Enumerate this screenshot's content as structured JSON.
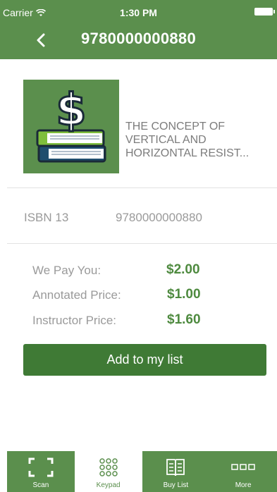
{
  "status": {
    "carrier": "Carrier",
    "time": "1:30 PM"
  },
  "header": {
    "title": "9780000000880"
  },
  "book": {
    "title": "THE CONCEPT OF VERTICAL AND HORIZONTAL RESIST..."
  },
  "isbn": {
    "label": "ISBN 13",
    "value": "9780000000880"
  },
  "prices": [
    {
      "label": "We Pay You:",
      "value": "$2.00"
    },
    {
      "label": "Annotated Price:",
      "value": "$1.00"
    },
    {
      "label": "Instructor Price:",
      "value": "$1.60"
    }
  ],
  "actions": {
    "add_label": "Add to my list"
  },
  "tabs": [
    {
      "label": "Scan",
      "icon": "scan-frame-icon"
    },
    {
      "label": "Keypad",
      "icon": "keypad-icon"
    },
    {
      "label": "Buy List",
      "icon": "book-list-icon"
    },
    {
      "label": "More",
      "icon": "more-icon"
    }
  ],
  "colors": {
    "brand": "#5b8f4d",
    "button": "#3f7a35",
    "price": "#4e8a3f"
  }
}
